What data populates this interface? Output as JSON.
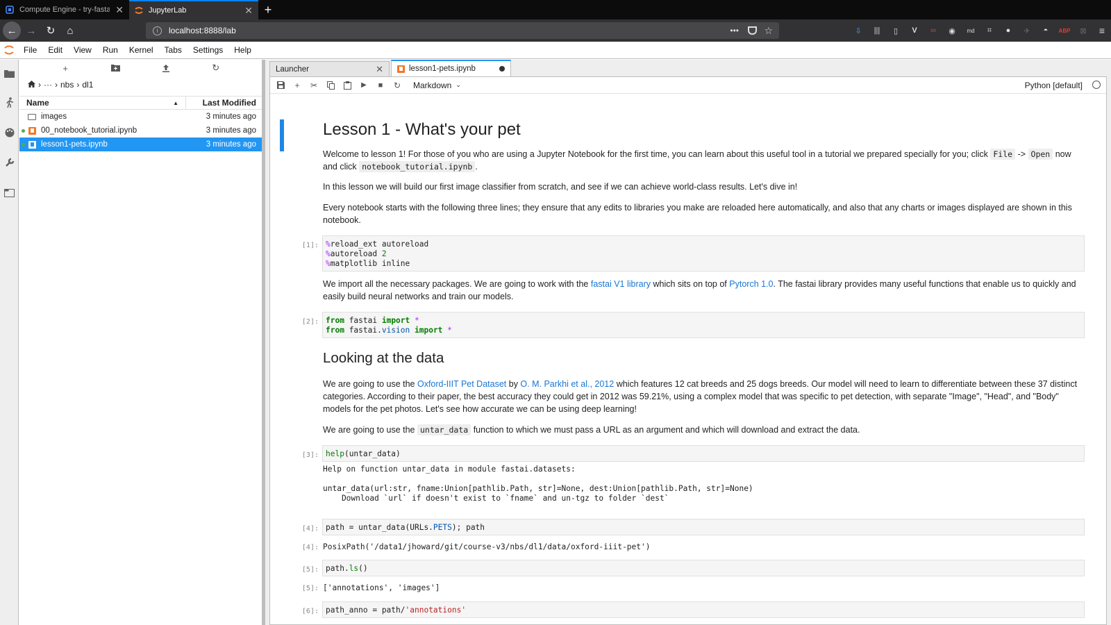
{
  "browser": {
    "tabs": [
      {
        "title": "Compute Engine - try-fastai - C",
        "active": false
      },
      {
        "title": "JupyterLab",
        "active": true
      }
    ],
    "url": "localhost:8888/lab",
    "accent": "#0a84ff"
  },
  "menubar": {
    "items": [
      "File",
      "Edit",
      "View",
      "Run",
      "Kernel",
      "Tabs",
      "Settings",
      "Help"
    ]
  },
  "sidebar_icons": [
    "folder-icon",
    "running-icon",
    "palette-icon",
    "wrench-icon",
    "tabs-icon"
  ],
  "filebrowser": {
    "breadcrumbs": [
      "···",
      "nbs",
      "dl1"
    ],
    "columns": {
      "name": "Name",
      "modified": "Last Modified"
    },
    "files": [
      {
        "name": "images",
        "type": "folder",
        "modified": "3 minutes ago",
        "running": false,
        "selected": false
      },
      {
        "name": "00_notebook_tutorial.ipynb",
        "type": "notebook",
        "modified": "3 minutes ago",
        "running": true,
        "selected": false
      },
      {
        "name": "lesson1-pets.ipynb",
        "type": "notebook",
        "modified": "3 minutes ago",
        "running": true,
        "selected": true
      }
    ],
    "selection_color": "#2196f3"
  },
  "doctabs": [
    {
      "title": "Launcher",
      "active": false
    },
    {
      "title": "lesson1-pets.ipynb",
      "active": true,
      "unsaved": true
    }
  ],
  "nbtoolbar": {
    "cell_type": "Markdown",
    "kernel": "Python [default]"
  },
  "notebook": {
    "title": "Lesson 1 - What's your pet",
    "p1_a": "Welcome to lesson 1! For those of you who are using a Jupyter Notebook for the first time, you can learn about this useful tool in a tutorial we prepared specially for you; click ",
    "p1_code1": "File",
    "p1_arrow": "->",
    "p1_code2": "Open",
    "p1_b": " now and click ",
    "p1_code3": "notebook_tutorial.ipynb",
    "p1_c": ".",
    "p2": "In this lesson we will build our first image classifier from scratch, and see if we can achieve world-class results. Let's dive in!",
    "p3": "Every notebook starts with the following three lines; they ensure that any edits to libraries you make are reloaded here automatically, and also that any charts or images displayed are shown in this notebook.",
    "cell1_prompt": "[1]:",
    "p4_a": "We import all the necessary packages. We are going to work with the ",
    "p4_link1": "fastai V1 library",
    "p4_b": " which sits on top of ",
    "p4_link2": "Pytorch 1.0",
    "p4_c": ". The fastai library provides many useful functions that enable us to quickly and easily build neural networks and train our models.",
    "cell2_prompt": "[2]:",
    "h2": "Looking at the data",
    "p5_a": "We are going to use the ",
    "p5_link1": "Oxford-IIIT Pet Dataset",
    "p5_b": " by ",
    "p5_link2": "O. M. Parkhi et al., 2012",
    "p5_c": " which features 12 cat breeds and 25 dogs breeds. Our model will need to learn to differentiate between these 37 distinct categories. According to their paper, the best accuracy they could get in 2012 was 59.21%, using a complex model that was specific to pet detection, with separate \"Image\", \"Head\", and \"Body\" models for the pet photos. Let's see how accurate we can be using deep learning!",
    "p6_a": "We are going to use the ",
    "p6_code": "untar_data",
    "p6_b": " function to which we must pass a URL as an argument and which will download and extract the data.",
    "cell3_prompt": "[3]:",
    "cell3_out": "Help on function untar_data in module fastai.datasets:\n\nuntar_data(url:str, fname:Union[pathlib.Path, str]=None, dest:Union[pathlib.Path, str]=None)\n    Download `url` if doesn't exist to `fname` and un-tgz to folder `dest`",
    "cell4_prompt": "[4]:",
    "cell4_out_prompt": "[4]:",
    "cell4_out": "PosixPath('/data1/jhoward/git/course-v3/nbs/dl1/data/oxford-iiit-pet')",
    "cell5_prompt": "[5]:",
    "cell5_out_prompt": "[5]:",
    "cell5_out": "['annotations', 'images']",
    "cell6_prompt": "[6]:"
  },
  "code": {
    "c1_l1_mag": "%",
    "c1_l1": "reload_ext autoreload",
    "c1_l2_mag": "%",
    "c1_l2": "autoreload ",
    "c1_l2_num": "2",
    "c1_l3_mag": "%",
    "c1_l3": "matplotlib inline",
    "c2_from": "from",
    "c2_mod1": " fastai ",
    "c2_import": "import",
    "c2_star": " *",
    "c2_from2": "from",
    "c2_mod2a": " fastai.",
    "c2_mod2b": "vision",
    "c2_import2": " import",
    "c2_star2": " *",
    "c3_fn": "help",
    "c3_rest": "(untar_data)",
    "c4_a": "path = untar_data(URLs.",
    "c4_attr": "PETS",
    "c4_b": "); path",
    "c5_a": "path.",
    "c5_fn": "ls",
    "c5_b": "()",
    "c6_a": "path_anno = path/",
    "c6_str": "'annotations'"
  }
}
